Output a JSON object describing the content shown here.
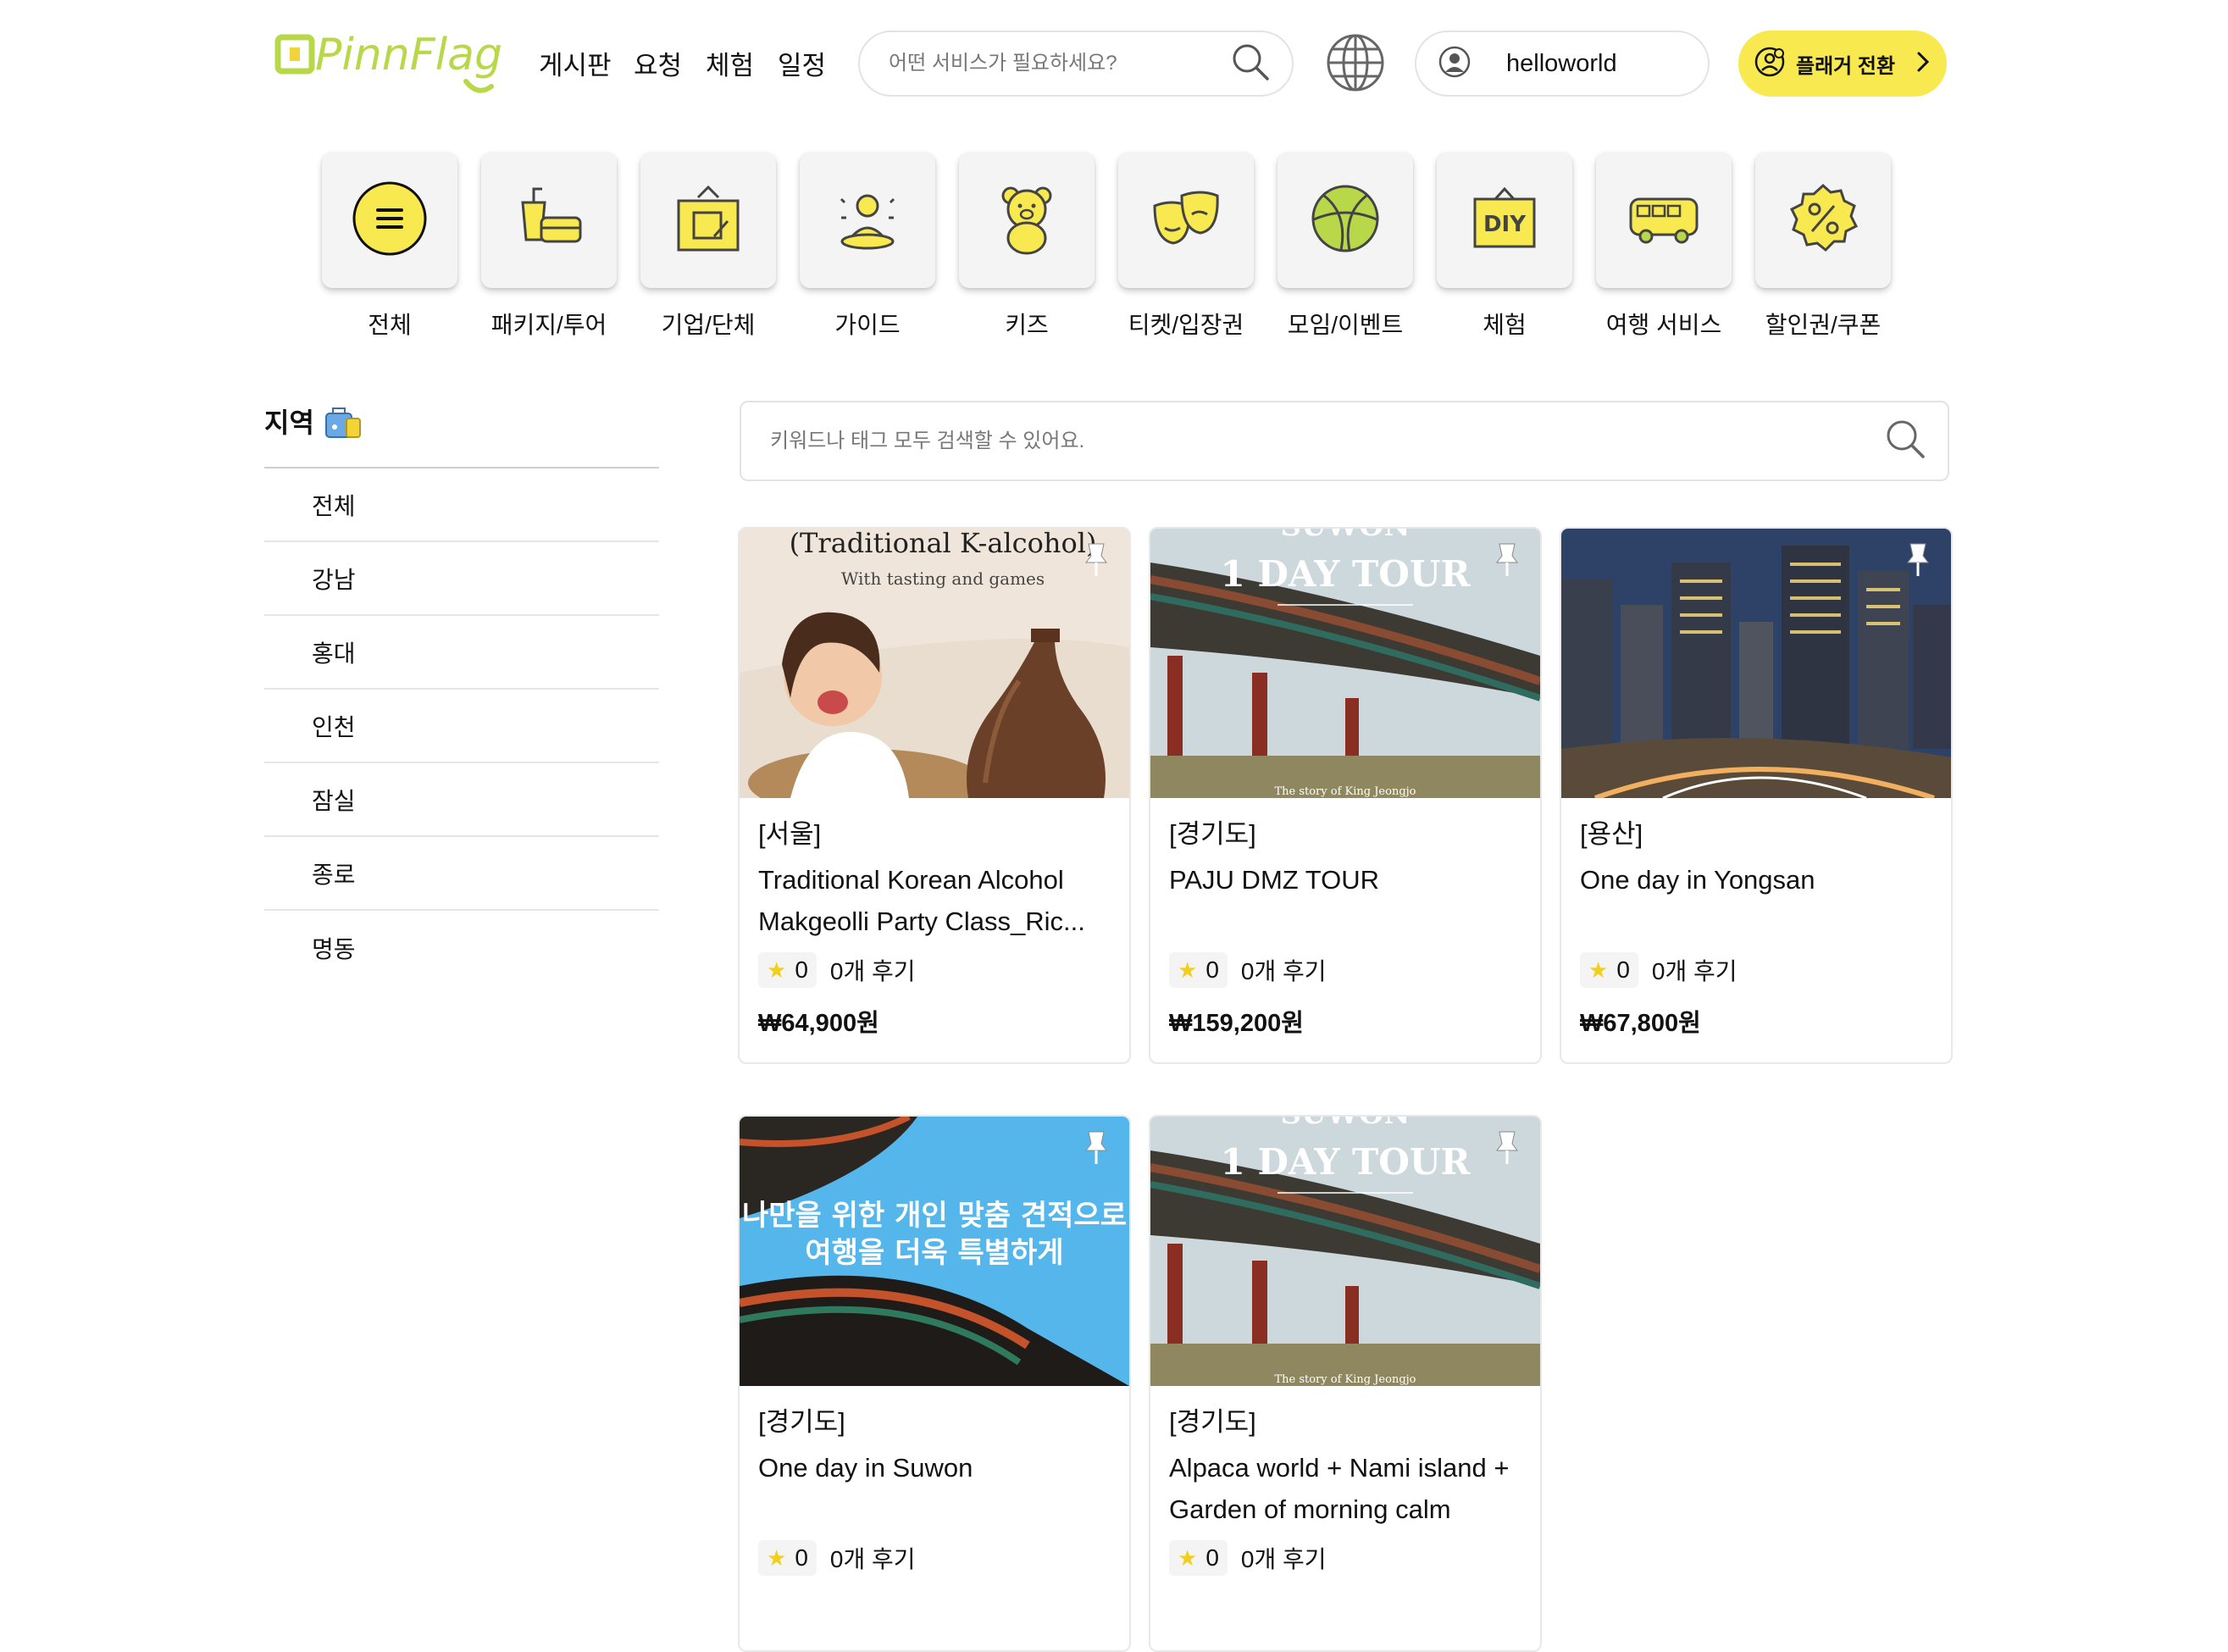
{
  "header": {
    "logo_text": "PinnFlag",
    "nav": [
      "게시판",
      "요청",
      "체험",
      "일정"
    ],
    "search_placeholder": "어떤 서비스가 필요하세요?",
    "username": "helloworld",
    "planner_button": "플래거 전환",
    "accent_color": "#f7e94f"
  },
  "categories": [
    {
      "label": "전체",
      "icon": "menu-icon"
    },
    {
      "label": "패키지/투어",
      "icon": "package-tour-icon"
    },
    {
      "label": "기업/단체",
      "icon": "company-group-icon"
    },
    {
      "label": "가이드",
      "icon": "guide-icon"
    },
    {
      "label": "키즈",
      "icon": "kids-bear-icon"
    },
    {
      "label": "티켓/입장권",
      "icon": "ticket-masks-icon"
    },
    {
      "label": "모임/이벤트",
      "icon": "event-ball-icon"
    },
    {
      "label": "체험",
      "icon": "diy-icon"
    },
    {
      "label": "여행 서비스",
      "icon": "bus-icon"
    },
    {
      "label": "할인권/쿠폰",
      "icon": "coupon-icon"
    }
  ],
  "sidebar": {
    "title": "지역",
    "regions": [
      "전체",
      "강남",
      "홍대",
      "인천",
      "잠실",
      "종로",
      "명동"
    ]
  },
  "keyword_search": {
    "placeholder": "키워드나 태그 모두 검색할 수 있어요."
  },
  "images": {
    "alcohol": {
      "title": "(Traditional K-alcohol)",
      "subtitle": "With tasting and games"
    },
    "suwon": {
      "top": "SUWON",
      "title": "1 DAY TOUR",
      "caption": "The story of King Jeongjo"
    },
    "custom": {
      "line1": "나만을 위한 개인 맞춤 견적으로",
      "line2": "여행을 더욱 특별하게"
    }
  },
  "products": [
    {
      "region": "[서울]",
      "title": "Traditional Korean Alcohol Makgeolli Party Class_Ric...",
      "rating": "0",
      "reviews": "0개 후기",
      "price": "₩64,900원"
    },
    {
      "region": "[경기도]",
      "title": "PAJU DMZ TOUR",
      "rating": "0",
      "reviews": "0개 후기",
      "price": "₩159,200원"
    },
    {
      "region": "[용산]",
      "title": "One day in Yongsan",
      "rating": "0",
      "reviews": "0개 후기",
      "price": "₩67,800원"
    },
    {
      "region": "[경기도]",
      "title": "One day in Suwon",
      "rating": "0",
      "reviews": "0개 후기",
      "price": ""
    },
    {
      "region": "[경기도]",
      "title": "Alpaca world + Nami island + Garden of morning calm",
      "rating": "0",
      "reviews": "0개 후기",
      "price": ""
    }
  ]
}
